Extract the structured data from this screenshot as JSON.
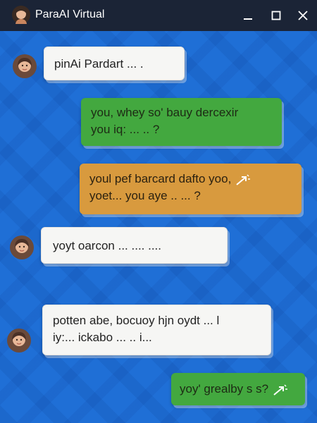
{
  "window": {
    "title": "ParaAI Virtual",
    "controls": {
      "minimize": "minimize",
      "maximize": "maximize",
      "close": "close"
    }
  },
  "messages": [
    {
      "side": "in",
      "lines": [
        "pinAi Pardart  ... ."
      ]
    },
    {
      "side": "out",
      "color": "green",
      "lines": [
        "you, whey so' bauy dercexir",
        "you iq: ... .. ?"
      ]
    },
    {
      "side": "out",
      "color": "orange",
      "lines": [
        "youl pef barcard dafto yoo,",
        "yoet... you aye .. ... ?"
      ]
    },
    {
      "side": "in",
      "lines": [
        "yoyt oarcon  ... .... ...."
      ]
    },
    {
      "side": "in",
      "lines": [
        "potten abe, bocuoy hjn oydt ... l",
        "iy:... ickabo   ... .. i..."
      ]
    },
    {
      "side": "out",
      "color": "green",
      "lines": [
        "yoy' grealby s s?"
      ]
    }
  ],
  "icons": {
    "title_avatar": "user-avatar-icon",
    "message_avatar": "user-avatar-icon",
    "reaction": "sparkle-arrow-icon"
  },
  "colors": {
    "titlebar": "#1b2436",
    "background": "#1f6fd6",
    "bubble_in": "#f6f6f4",
    "bubble_green": "#43a83f",
    "bubble_orange": "#d89a3e"
  }
}
